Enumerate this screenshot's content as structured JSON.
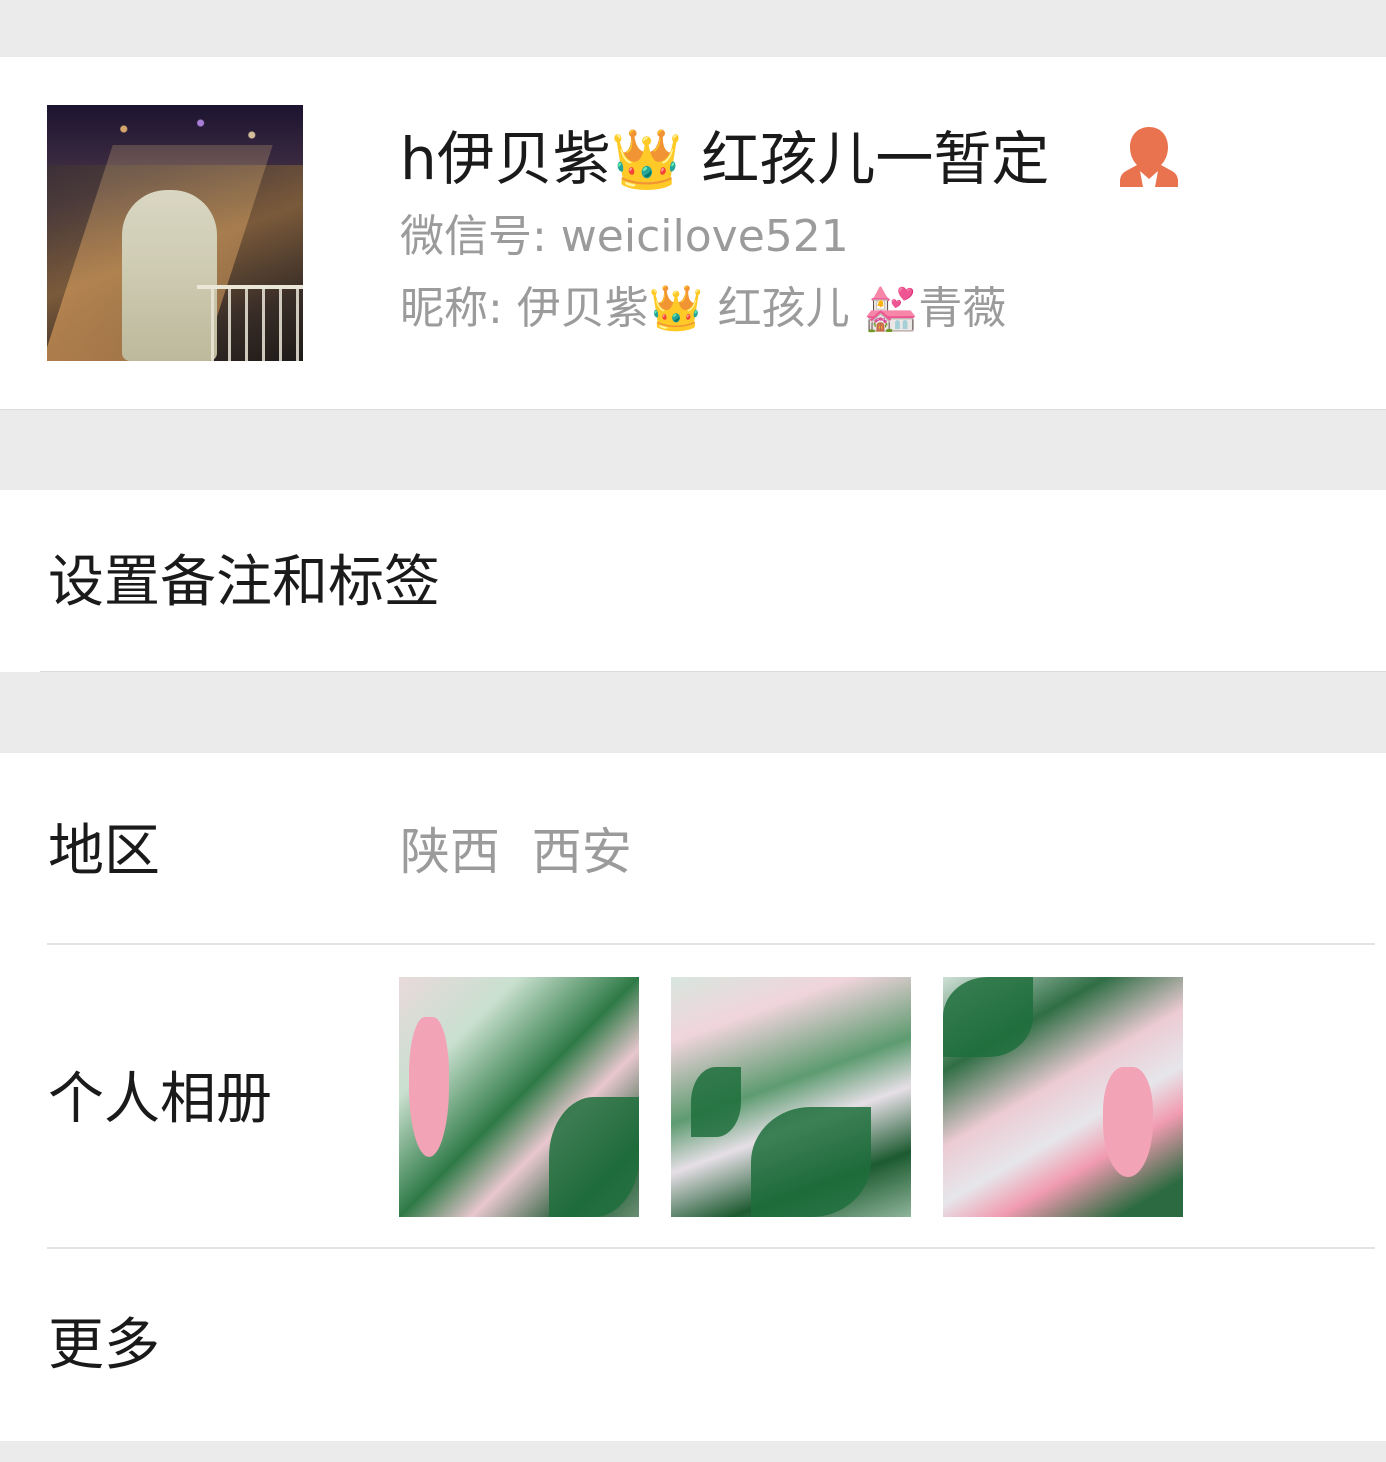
{
  "profile": {
    "name": "h伊贝紫👑 红孩儿一暂定",
    "wechat_id": "微信号: weicilove521",
    "nickname": "昵称: 伊贝紫👑 红孩儿 💒青薇",
    "gender_icon": "female-icon",
    "accent_color": "#e9734f"
  },
  "remark": {
    "label": "设置备注和标签"
  },
  "info": {
    "region_label": "地区",
    "region_value": "陕西  西安",
    "album_label": "个人相册",
    "more_label": "更多"
  }
}
